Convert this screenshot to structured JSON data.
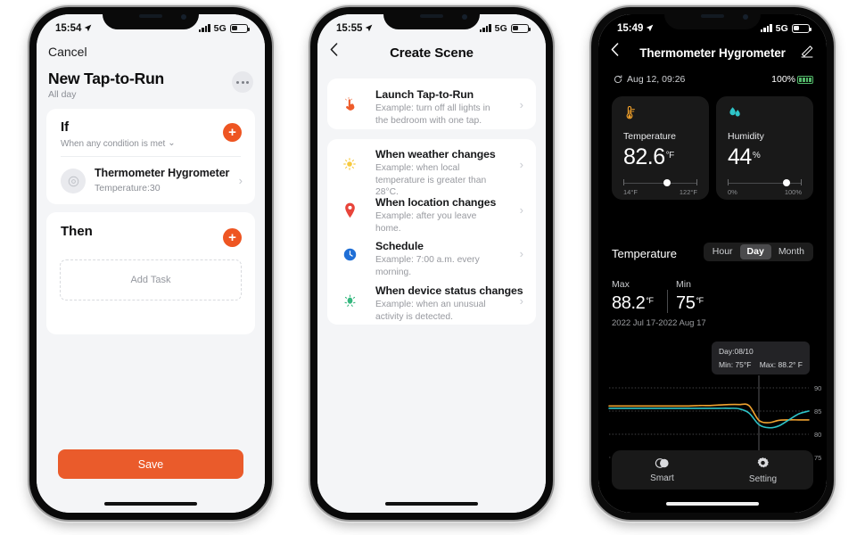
{
  "phone1": {
    "status": {
      "time": "15:54",
      "network": "5G"
    },
    "cancel_label": "Cancel",
    "title": "New Tap-to-Run",
    "subtitle": "All day",
    "more_icon": "ellipsis-icon",
    "if_section": {
      "heading": "If",
      "condition": "When any condition is met",
      "caret": "⌄",
      "add_label": "+",
      "device": {
        "name": "Thermometer Hygrometer",
        "value": "Temperature:30",
        "chevron": "›"
      }
    },
    "then_section": {
      "heading": "Then",
      "add_label": "+",
      "add_task_label": "Add Task"
    },
    "save_label": "Save",
    "accent": "#ea5b2b"
  },
  "phone2": {
    "status": {
      "time": "15:55",
      "network": "5G"
    },
    "back_icon": "chevron-left-icon",
    "title": "Create Scene",
    "options": [
      {
        "icon": "tap-hand-icon",
        "glyph": "☝",
        "title": "Launch Tap-to-Run",
        "desc": "Example: turn off all lights in the bedroom with one tap."
      },
      {
        "icon": "sun-icon",
        "glyph": "☀",
        "title": "When weather changes",
        "desc": "Example: when local temperature is greater than 28°C."
      },
      {
        "icon": "location-pin-icon",
        "glyph": "📍",
        "title": "When location changes",
        "desc": "Example: after you leave home."
      },
      {
        "icon": "clock-icon",
        "glyph": "🕐",
        "title": "Schedule",
        "desc": "Example: 7:00 a.m. every morning."
      },
      {
        "icon": "sensor-icon",
        "glyph": "✸",
        "title": "When device status changes",
        "desc": "Example: when an unusual activity is detected."
      }
    ],
    "chevron": "›"
  },
  "phone3": {
    "status": {
      "time": "15:49",
      "network": "5G"
    },
    "back_icon": "chevron-left-icon",
    "title": "Thermometer Hygrometer",
    "edit_icon": "pencil-icon",
    "refresh_icon": "refresh-icon",
    "updated": "Aug 12, 09:26",
    "battery": "100%",
    "tiles": [
      {
        "icon": "thermometer-icon",
        "label": "Temperature",
        "value": "82.6",
        "unit": "°F",
        "min": "14°F",
        "max": "122°F",
        "knob_pct": 54
      },
      {
        "icon": "water-drop-icon",
        "label": "Humidity",
        "value": "44",
        "unit": "%",
        "min": "0%",
        "max": "100%",
        "knob_pct": 75
      }
    ],
    "section_label": "Temperature",
    "segments": [
      {
        "label": "Hour",
        "active": false
      },
      {
        "label": "Day",
        "active": true
      },
      {
        "label": "Month",
        "active": false
      }
    ],
    "stats": {
      "max_label": "Max",
      "max_value": "88.2",
      "max_unit": "°F",
      "min_label": "Min",
      "min_value": "75",
      "min_unit": "°F",
      "range": "2022 Jul 17-2022 Aug 17"
    },
    "tooltip": {
      "day": "Day:08/10",
      "min": "Min: 75°F",
      "max": "Max: 88.2° F"
    },
    "tabs": [
      {
        "icon": "smart-icon",
        "glyph": "◐",
        "label": "Smart"
      },
      {
        "icon": "gear-icon",
        "glyph": "⚙",
        "label": "Setting"
      }
    ]
  },
  "chart_data": {
    "type": "line",
    "title": "Temperature",
    "xlabel": "",
    "ylabel": "°F",
    "ylim": [
      75,
      90
    ],
    "yticks": [
      75,
      80,
      85,
      90
    ],
    "grid": true,
    "legend": "none",
    "x": [
      0,
      1,
      2,
      3,
      4,
      5,
      6,
      7,
      8,
      9,
      10,
      11,
      12,
      13,
      14,
      15,
      16,
      17,
      18,
      19,
      20
    ],
    "series": [
      {
        "name": "Max",
        "color": "#f0a330",
        "values": [
          86.1,
          86.1,
          86.1,
          86.1,
          86.1,
          86.1,
          86.1,
          86.1,
          86.1,
          86.2,
          86.2,
          86.3,
          86.4,
          86.4,
          86.2,
          83.0,
          82.5,
          83.0,
          83.1,
          83.1,
          83.1
        ]
      },
      {
        "name": "Min",
        "color": "#2ec4c8",
        "values": [
          85.6,
          85.6,
          85.6,
          85.6,
          85.6,
          85.6,
          85.6,
          85.6,
          85.6,
          85.6,
          85.6,
          85.6,
          85.6,
          85.5,
          84.6,
          82.1,
          81.4,
          81.8,
          83.1,
          84.4,
          85.0
        ]
      }
    ],
    "marker_x": 15,
    "marker_label": "Day:08/10"
  }
}
